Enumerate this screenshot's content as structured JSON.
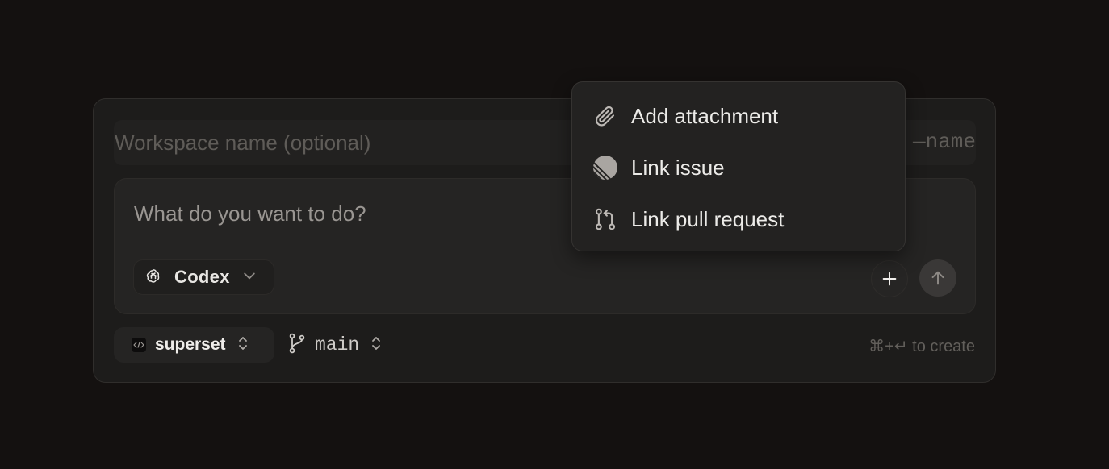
{
  "workspace": {
    "name_placeholder": "Workspace name (optional)",
    "branch_hint": "—name"
  },
  "prompt": {
    "placeholder": "What do you want to do?"
  },
  "agent": {
    "label": "Codex",
    "icon": "openai-icon"
  },
  "repo": {
    "label": "superset",
    "icon": "code-icon"
  },
  "branch": {
    "label": "main",
    "icon": "git-branch-icon"
  },
  "shortcut_hint": "⌘+↵ to create",
  "menu": {
    "items": [
      {
        "label": "Add attachment",
        "icon": "paperclip-icon"
      },
      {
        "label": "Link issue",
        "icon": "linear-icon"
      },
      {
        "label": "Link pull request",
        "icon": "git-pull-request-icon"
      }
    ]
  },
  "colors": {
    "background": "#141110",
    "panel": "#1d1c1b",
    "menu": "#232221"
  }
}
